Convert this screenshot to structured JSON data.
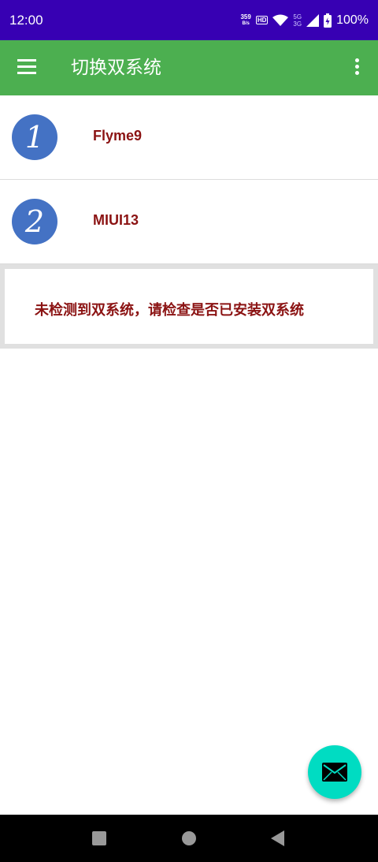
{
  "status_bar": {
    "time": "12:00",
    "net_speed_value": "359",
    "net_speed_unit": "B/s",
    "hd_badge": "HD",
    "net_type_top": "5G",
    "net_type_bottom": "3G",
    "battery": "100%",
    "background_color": "#3700b3"
  },
  "app_bar": {
    "title": "切换双系统",
    "menu_icon": "menu-icon",
    "more_icon": "more-vert-icon",
    "background_color": "#4caf50"
  },
  "systems": [
    {
      "number": "1",
      "label": "Flyme9"
    },
    {
      "number": "2",
      "label": "MIUI13"
    }
  ],
  "notice": {
    "text": "未检测到双系统，请检查是否已安装双系统"
  },
  "fab": {
    "icon": "mail-icon",
    "color": "#00dcc2"
  },
  "nav_bar": {
    "recent_icon": "square-icon",
    "home_icon": "circle-icon",
    "back_icon": "triangle-back-icon"
  },
  "accent_text_color": "#8b1313",
  "circle_color": "#4472c4"
}
